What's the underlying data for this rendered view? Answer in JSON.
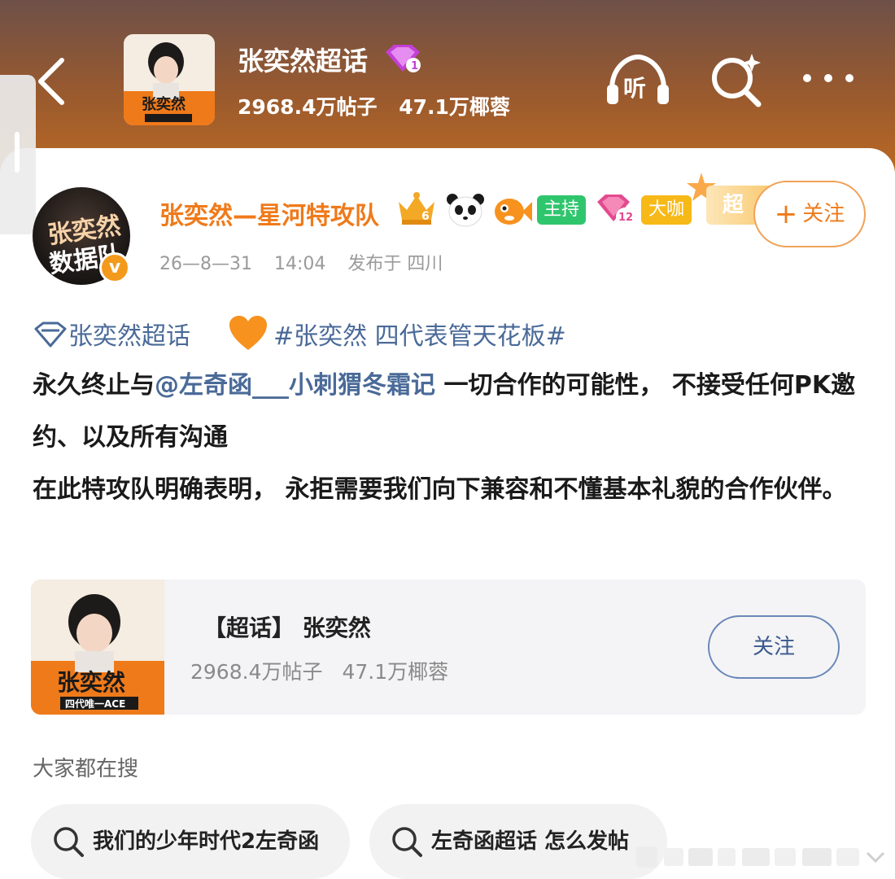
{
  "header": {
    "title": "张奕然超话",
    "stats": {
      "posts": "2968.4万帖子",
      "fans": "47.1万椰蓉"
    },
    "gem_level": "1",
    "colors": {
      "gradient_top": "#6e5048",
      "gradient_bottom": "#c9701e"
    }
  },
  "post": {
    "author": {
      "name": "张奕然—星河特攻队",
      "avatar_text_line1": "张奕然",
      "avatar_text_line2": "数据队",
      "verified_mark": "v",
      "badges": {
        "crown_level": "6",
        "host_label": "主持",
        "gem_level": "12",
        "big_label": "大咖",
        "super_label": "超"
      }
    },
    "follow_label": "关注",
    "meta": {
      "date": "26—8—31",
      "time": "14:04",
      "location": "发布于  四川"
    },
    "topic_link": "张奕然超话",
    "hashtag": "#张奕然  四代表管天花板#",
    "body": {
      "line1_prefix": "永久终止与",
      "mention": "@左奇函___小刺猬冬霜记",
      "line1_suffix": " 一切合作的可能性， 不接受任何PK邀约、以及所有沟通",
      "line2": "在此特攻队明确表明， 永拒需要我们向下兼容和不懂基本礼貌的合作伙伴。"
    }
  },
  "topic_card": {
    "name": "【超话】 张奕然",
    "posts": "2968.4万帖子",
    "fans": "47.1万椰蓉",
    "follow_label": "关注",
    "thumb_text": "张奕然",
    "thumb_subtext": "四代唯一ACE"
  },
  "search": {
    "section_title": "大家都在搜",
    "chips": [
      "我们的少年时代2左奇函",
      "左奇函超话  怎么发帖"
    ]
  },
  "icons": {
    "back": "chevron-left-icon",
    "listen": "headphones-listen-icon",
    "search": "search-sparkle-icon",
    "more": "more-dots-icon"
  }
}
